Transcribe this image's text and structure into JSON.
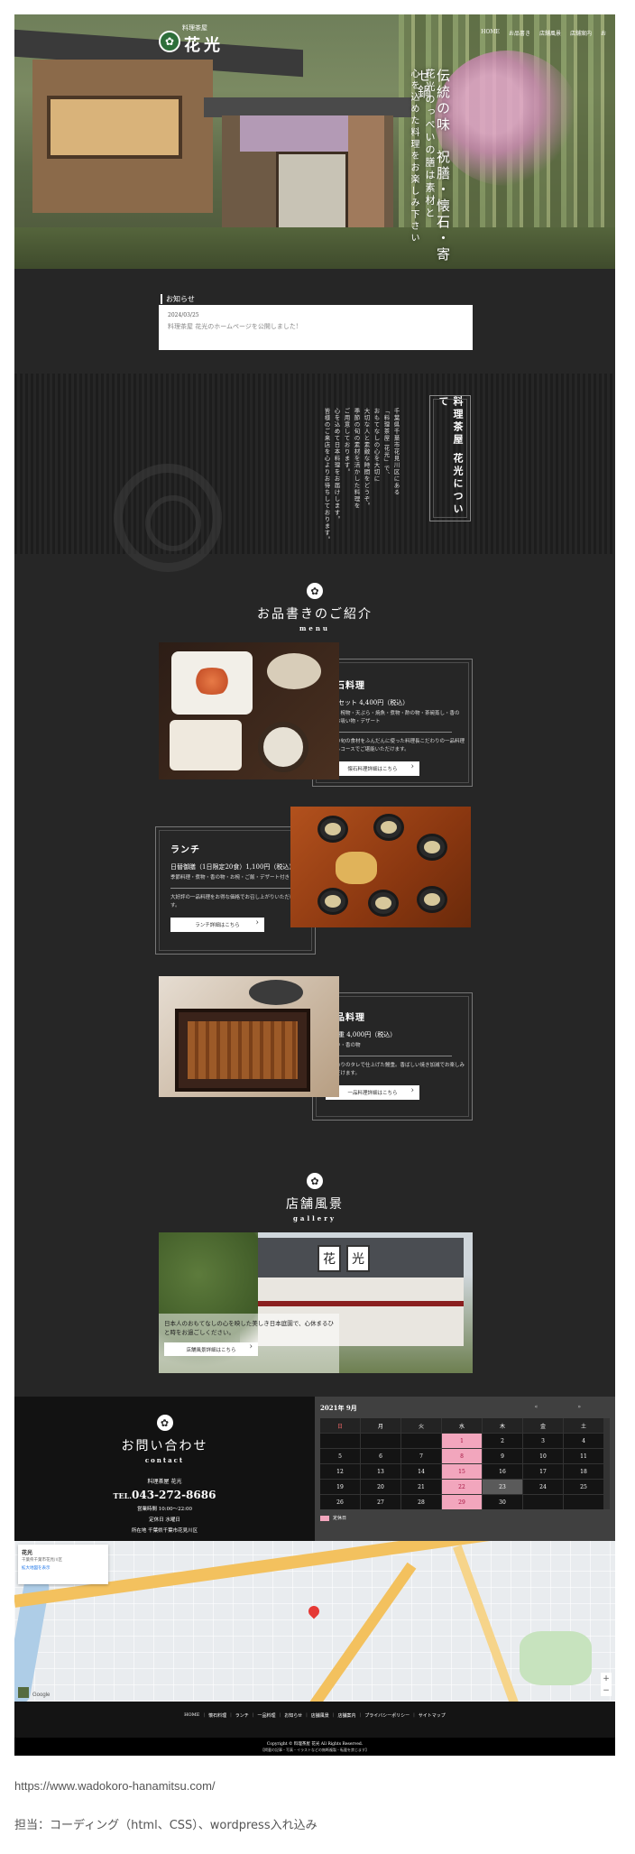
{
  "header": {
    "logo_small": "料理茶屋",
    "logo_name": "花光",
    "nav": [
      "HOME",
      "お品書き",
      "店舗風景",
      "店舗案内",
      "お"
    ]
  },
  "hero": {
    "line1": "伝統の味　祝膳・懐石・寄せ鍋",
    "line2": "花光のっぺいの膳は素材と",
    "line3": "心を込めた料理をお楽しみ下さい"
  },
  "news": {
    "label": "お知らせ",
    "date": "2024/03/25",
    "text": "料理茶屋 花光のホームページを公開しました!"
  },
  "about": {
    "title": "料理茶屋 花光について",
    "lines": [
      "千葉県千葉市花見川区にある",
      "「料理茶屋 花光」で、",
      "おもてなしの心を大切に",
      "大切な人と素敵な時間をどうぞ。",
      "季節の旬の素材を活かした料理を",
      "ご用意しております。",
      "心を込めて日本料理をお届けします。",
      "皆様のご来店を心よりお待ちしております。"
    ]
  },
  "menu": {
    "heading": "お品書きのご紹介",
    "heading_en": "menu",
    "items": [
      {
        "name": "懐石料理",
        "price": "懐石セット 4,400円（税込）",
        "items": "前菜・椀物・天ぷら・焼魚・煮物・酢の物・茶碗蒸し・香の物・お吸い物・デザート",
        "desc": "季節の旬の食材をふんだんに使った料理長こだわりの一品料理をフルコースでご堪能いただけます。",
        "button": "懐石料理詳細はこちら"
      },
      {
        "name": "ランチ",
        "price": "日替御膳（1日限定20食）1,100円（税込）",
        "items": "季節料理・煮物・香の物・お椀・ご飯・デザート付き",
        "desc": "大好評の一品料理をお得な価格でお召し上がりいただけます。",
        "button": "ランチ詳細はこちら"
      },
      {
        "name": "一品料理",
        "price": "うな重 4,000円（税込）",
        "items": "肝吸い・香の物",
        "desc": "こだわりのタレで仕上げた鰻重。香ばしい焼き加減でお楽しみいただけます。",
        "button": "一品料理詳細はこちら"
      }
    ]
  },
  "gallery": {
    "heading": "店舗風景",
    "heading_en": "gallery",
    "caption": "日本人のおもてなしの心を映した美しき日本庭園で、心休まるひと時をお過ごしください。",
    "button": "店舗風景詳細はこちら",
    "sign_chars": [
      "花",
      "光"
    ]
  },
  "contact": {
    "heading": "お問い合わせ",
    "heading_en": "contact",
    "store": "料理茶屋 花光",
    "tel_prefix": "TEL.",
    "tel": "043-272-8686",
    "hours": "営業時間 10:00～22:00",
    "closed": "定休日 水曜日",
    "address": "所在地 千葉県千葉市花見川区　"
  },
  "calendar": {
    "title": "2021年 9月",
    "prev": "«",
    "next": "»",
    "weekdays": [
      "日",
      "月",
      "火",
      "水",
      "木",
      "金",
      "土"
    ],
    "cells": [
      "",
      "",
      "",
      "1",
      "2",
      "3",
      "4",
      "5",
      "6",
      "7",
      "8",
      "9",
      "10",
      "11",
      "12",
      "13",
      "14",
      "15",
      "16",
      "17",
      "18",
      "19",
      "20",
      "21",
      "22",
      "23",
      "24",
      "25",
      "26",
      "27",
      "28",
      "29",
      "30",
      "",
      ""
    ],
    "closed_days": [
      "1",
      "8",
      "15",
      "22",
      "29"
    ],
    "today": "23",
    "legend": "定休日",
    "closed_color": "#f2a6bd"
  },
  "map": {
    "place_title": "花光",
    "place_address": "千葉県千葉市花見川区",
    "place_link": "拡大地図を表示",
    "zoom_in": "+",
    "zoom_out": "−",
    "attribution": "Google"
  },
  "footer": {
    "links": [
      "HOME",
      "懐石料理",
      "ランチ",
      "一品料理",
      "お知らせ",
      "店舗風景",
      "店舗案内",
      "プライバシーポリシー",
      "サイトマップ"
    ],
    "copyright": "Copyright © 料理茶屋 花光 All Rights Reserved.",
    "note": "【掲載の記事・写真・イラストなどの無断複製・転載を禁じます】"
  },
  "captions": {
    "url": "https://www.wadokoro-hanamitsu.com/",
    "role": "担当：コーディング（html、CSS）、wordpress入れ込み"
  }
}
